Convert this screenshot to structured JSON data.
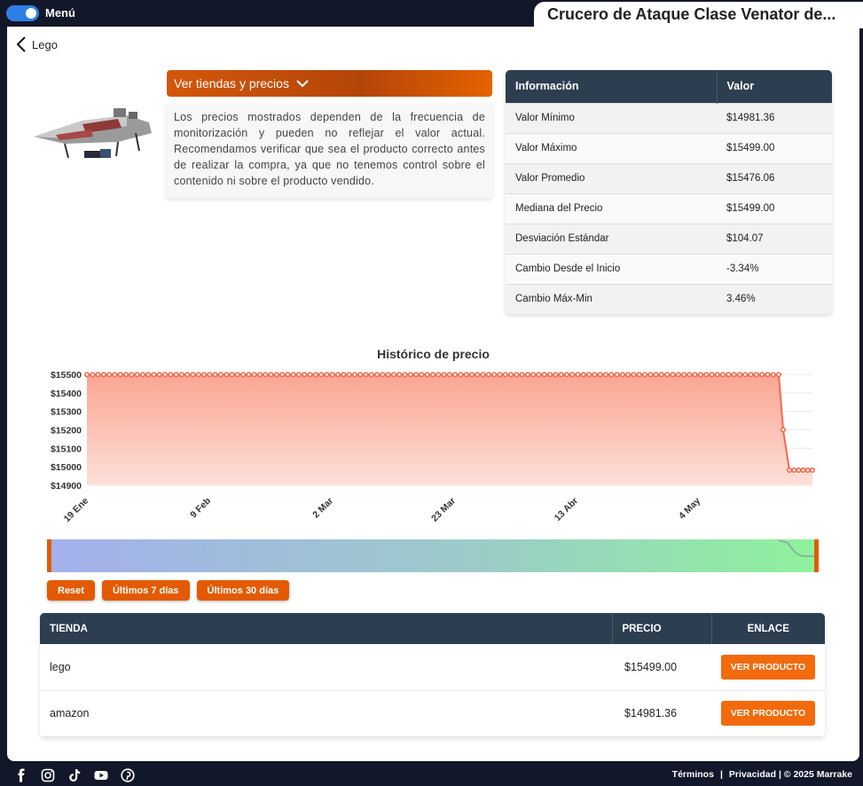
{
  "topbar": {
    "menu_label": "Menú",
    "page_title": "Crucero de Ataque Clase Venator de..."
  },
  "back": {
    "label": "Lego"
  },
  "accordion": {
    "title": "Ver tiendas y precios",
    "disclaimer": "Los precios mostrados dependen de la frecuencia de monitorización y pueden no reflejar el valor actual. Recomendamos verificar que sea el producto correcto antes de realizar la compra, ya que no tenemos control sobre el contenido ni sobre el producto vendido."
  },
  "info_table": {
    "headers": [
      "Información",
      "Valor"
    ],
    "rows": [
      {
        "label": "Valor Mínimo",
        "value": "$14981.36"
      },
      {
        "label": "Valor Máximo",
        "value": "$15499.00"
      },
      {
        "label": "Valor Promedio",
        "value": "$15476.06"
      },
      {
        "label": "Mediana del Precio",
        "value": "$15499.00"
      },
      {
        "label": "Desviación Estándar",
        "value": "$104.07"
      },
      {
        "label": "Cambio Desde el Inicio",
        "value": "-3.34%"
      },
      {
        "label": "Cambio Máx-Min",
        "value": "3.46%"
      }
    ]
  },
  "chart_data": {
    "type": "area",
    "title": "Histórico de precio",
    "y_ticks": [
      "$15500",
      "$15400",
      "$15300",
      "$15200",
      "$15100",
      "$15000",
      "$14900"
    ],
    "ylim": [
      14900,
      15500
    ],
    "x_ticks": [
      "19 Ene",
      "9 Feb",
      "2 Mar",
      "23 Mar",
      "13 Abr",
      "4 May"
    ],
    "series": [
      {
        "flat_value": 15499.0,
        "flat_points": 125,
        "transition": [
          15499.0,
          15200.0
        ],
        "final_value": 14981.36,
        "final_points": 6
      }
    ],
    "grid": true,
    "colors": {
      "line": "#f06a4f",
      "fill_top": "#fba592",
      "fill_bottom": "#fde0d8"
    }
  },
  "range_buttons": [
    "Reset",
    "Últimos 7 días",
    "Últimos 30 días"
  ],
  "stores_table": {
    "headers": [
      "TIENDA",
      "PRECIO",
      "ENLACE"
    ],
    "rows": [
      {
        "store": "lego",
        "price": "$15499.00",
        "link_label": "VER PRODUCTO"
      },
      {
        "store": "amazon",
        "price": "$14981.36",
        "link_label": "VER PRODUCTO"
      }
    ]
  },
  "footer": {
    "social_icons": [
      "facebook-icon",
      "instagram-icon",
      "tiktok-icon",
      "youtube-icon",
      "pinterest-icon"
    ],
    "terms": "Términos",
    "sep1": "|",
    "privacy": "Privacidad",
    "copyright": "| © 2025 Marrake"
  }
}
